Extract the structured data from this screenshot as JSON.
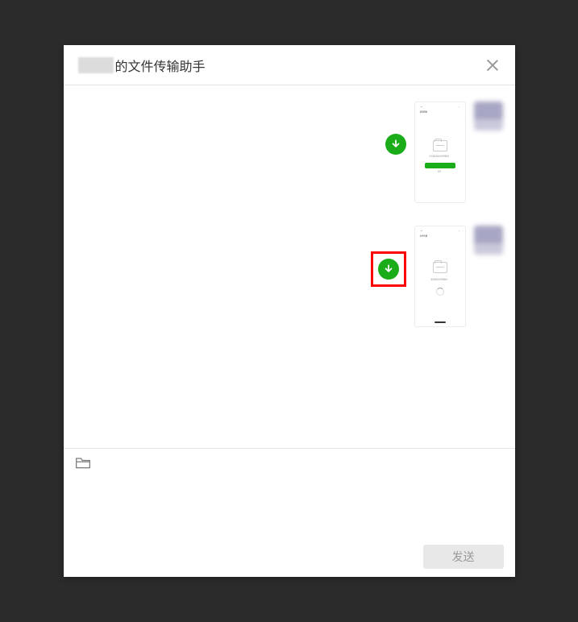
{
  "header": {
    "title_suffix": "的文件传输助手"
  },
  "messages": [
    {
      "phone_header": "使用帮助",
      "phone_text": "正在绑定登录文件传输助手",
      "phone_footer": "取消",
      "has_button": true,
      "highlighted": false
    },
    {
      "phone_header": "文件传输",
      "phone_text": "使用登录文件传输助手",
      "phone_footer": "",
      "has_button": false,
      "highlighted": true
    }
  ],
  "input": {
    "send_label": "发送"
  },
  "colors": {
    "accent": "#1aad19",
    "highlight": "#ff0000"
  }
}
